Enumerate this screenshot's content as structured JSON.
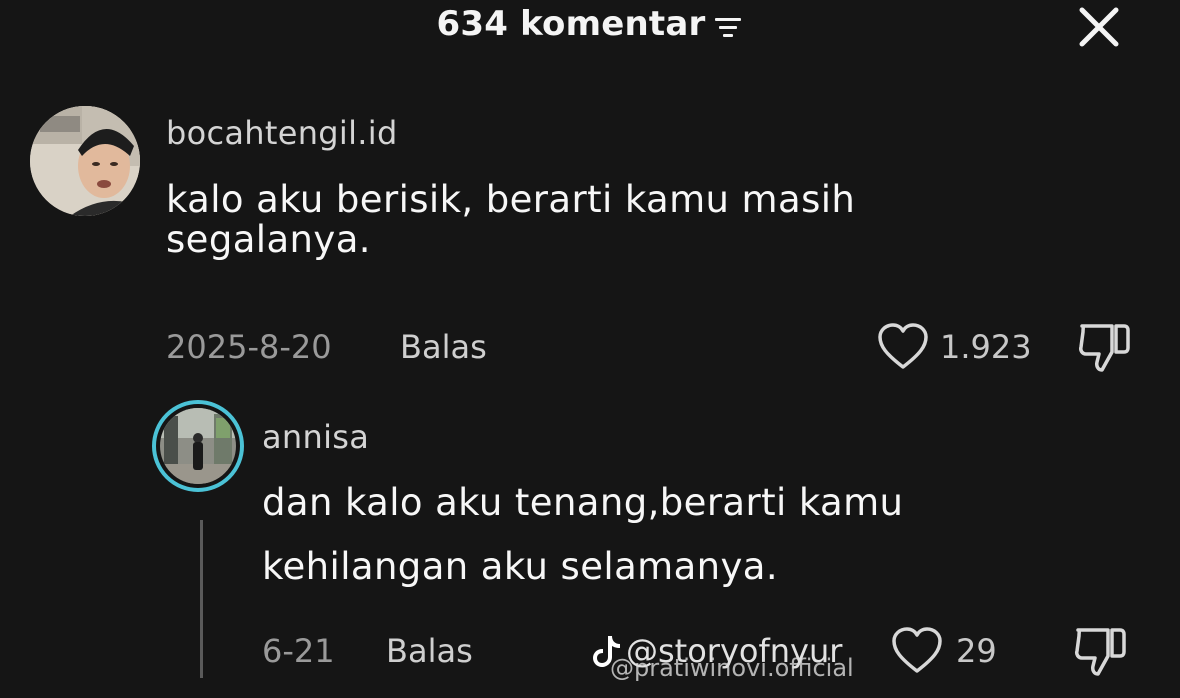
{
  "header": {
    "comment_count_label": "634 komentar",
    "filter_icon": "sort-filter-icon",
    "close_icon": "close-icon"
  },
  "comments": [
    {
      "username": "bocahtengil.id",
      "text_line1": "kalo aku berisik, berarti kamu masih",
      "text_line2": "segalanya.",
      "date": "2025-8-20",
      "reply_label": "Balas",
      "likes": "1.923",
      "like_icon": "heart-outline-icon",
      "dislike_icon": "thumbs-down-icon",
      "replies": [
        {
          "username": "annisa",
          "text_line1": "dan kalo aku tenang,berarti kamu",
          "text_line2": "kehilangan aku selamanya.",
          "date": "6-21",
          "reply_label": "Balas",
          "likes": "29",
          "like_icon": "heart-outline-icon",
          "dislike_icon": "thumbs-down-icon"
        }
      ]
    }
  ],
  "watermark": {
    "primary": "@storyofnyur",
    "secondary": "@pratiwinovi.official",
    "logo_icon": "tiktok-logo-icon"
  },
  "colors": {
    "background": "#151515",
    "avatar_ring": "#4bc2d6"
  }
}
